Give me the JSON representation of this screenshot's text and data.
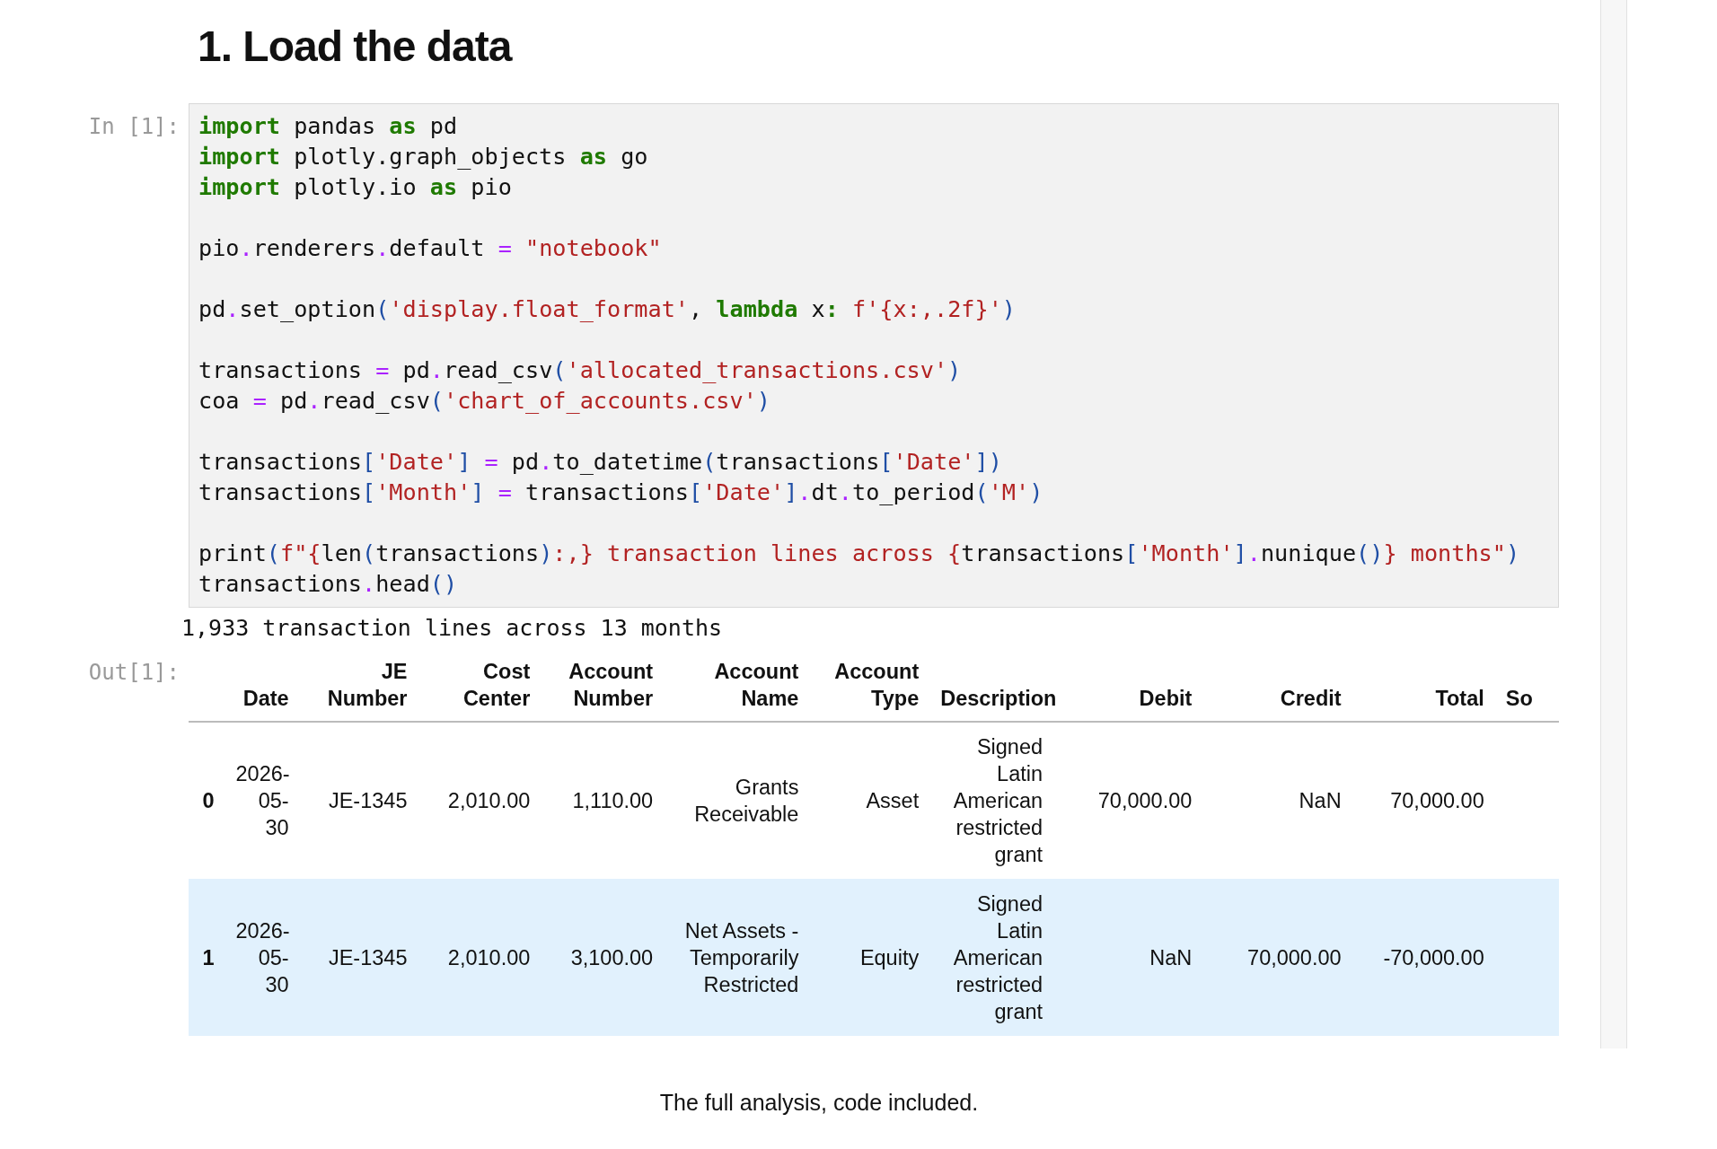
{
  "heading": "1. Load the data",
  "input_cell": {
    "prompt": "In [1]:",
    "lines": [
      {
        "kind": "code",
        "tokens": [
          {
            "kind": "kw",
            "text": "import"
          },
          {
            "kind": "plain",
            "text": " pandas "
          },
          {
            "kind": "kw",
            "text": "as"
          },
          {
            "kind": "plain",
            "text": " pd"
          }
        ]
      },
      {
        "kind": "code",
        "tokens": [
          {
            "kind": "kw",
            "text": "import"
          },
          {
            "kind": "plain",
            "text": " plotly.graph_objects "
          },
          {
            "kind": "kw",
            "text": "as"
          },
          {
            "kind": "plain",
            "text": " go"
          }
        ]
      },
      {
        "kind": "code",
        "tokens": [
          {
            "kind": "kw",
            "text": "import"
          },
          {
            "kind": "plain",
            "text": " plotly.io "
          },
          {
            "kind": "kw",
            "text": "as"
          },
          {
            "kind": "plain",
            "text": " pio"
          }
        ]
      },
      {
        "kind": "blank"
      },
      {
        "kind": "code",
        "tokens": [
          {
            "kind": "plain",
            "text": "pio"
          },
          {
            "kind": "op",
            "text": "."
          },
          {
            "kind": "plain",
            "text": "renderers"
          },
          {
            "kind": "op",
            "text": "."
          },
          {
            "kind": "plain",
            "text": "default "
          },
          {
            "kind": "op",
            "text": "="
          },
          {
            "kind": "str",
            "text": " \"notebook\""
          }
        ]
      },
      {
        "kind": "blank"
      },
      {
        "kind": "code",
        "tokens": [
          {
            "kind": "plain",
            "text": "pd"
          },
          {
            "kind": "op",
            "text": "."
          },
          {
            "kind": "plain",
            "text": "set_option"
          },
          {
            "kind": "paren",
            "text": "("
          },
          {
            "kind": "str",
            "text": "'display.float_format'"
          },
          {
            "kind": "plain",
            "text": ", "
          },
          {
            "kind": "kw",
            "text": "lambda"
          },
          {
            "kind": "plain",
            "text": " x"
          },
          {
            "kind": "kw",
            "text": ":"
          },
          {
            "kind": "str",
            "text": " f'{x:,.2f}'"
          },
          {
            "kind": "paren",
            "text": ")"
          }
        ]
      },
      {
        "kind": "blank"
      },
      {
        "kind": "code",
        "tokens": [
          {
            "kind": "plain",
            "text": "transactions "
          },
          {
            "kind": "op",
            "text": "="
          },
          {
            "kind": "plain",
            "text": " pd"
          },
          {
            "kind": "op",
            "text": "."
          },
          {
            "kind": "plain",
            "text": "read_csv"
          },
          {
            "kind": "paren",
            "text": "("
          },
          {
            "kind": "str",
            "text": "'allocated_transactions.csv'"
          },
          {
            "kind": "paren",
            "text": ")"
          }
        ]
      },
      {
        "kind": "code",
        "tokens": [
          {
            "kind": "plain",
            "text": "coa "
          },
          {
            "kind": "op",
            "text": "="
          },
          {
            "kind": "plain",
            "text": " pd"
          },
          {
            "kind": "op",
            "text": "."
          },
          {
            "kind": "plain",
            "text": "read_csv"
          },
          {
            "kind": "paren",
            "text": "("
          },
          {
            "kind": "str",
            "text": "'chart_of_accounts.csv'"
          },
          {
            "kind": "paren",
            "text": ")"
          }
        ]
      },
      {
        "kind": "blank"
      },
      {
        "kind": "code",
        "tokens": [
          {
            "kind": "plain",
            "text": "transactions"
          },
          {
            "kind": "paren",
            "text": "["
          },
          {
            "kind": "str",
            "text": "'Date'"
          },
          {
            "kind": "paren",
            "text": "] "
          },
          {
            "kind": "op",
            "text": "="
          },
          {
            "kind": "plain",
            "text": " pd"
          },
          {
            "kind": "op",
            "text": "."
          },
          {
            "kind": "plain",
            "text": "to_datetime"
          },
          {
            "kind": "paren",
            "text": "("
          },
          {
            "kind": "plain",
            "text": "transactions"
          },
          {
            "kind": "paren",
            "text": "["
          },
          {
            "kind": "str",
            "text": "'Date'"
          },
          {
            "kind": "paren",
            "text": "])"
          }
        ]
      },
      {
        "kind": "code",
        "tokens": [
          {
            "kind": "plain",
            "text": "transactions"
          },
          {
            "kind": "paren",
            "text": "["
          },
          {
            "kind": "str",
            "text": "'Month'"
          },
          {
            "kind": "paren",
            "text": "] "
          },
          {
            "kind": "op",
            "text": "="
          },
          {
            "kind": "plain",
            "text": " transactions"
          },
          {
            "kind": "paren",
            "text": "["
          },
          {
            "kind": "str",
            "text": "'Date'"
          },
          {
            "kind": "paren",
            "text": "]"
          },
          {
            "kind": "op",
            "text": "."
          },
          {
            "kind": "plain",
            "text": "dt"
          },
          {
            "kind": "op",
            "text": "."
          },
          {
            "kind": "plain",
            "text": "to_period"
          },
          {
            "kind": "paren",
            "text": "("
          },
          {
            "kind": "str",
            "text": "'M'"
          },
          {
            "kind": "paren",
            "text": ")"
          }
        ]
      },
      {
        "kind": "blank"
      },
      {
        "kind": "code",
        "tokens": [
          {
            "kind": "plain",
            "text": "print"
          },
          {
            "kind": "paren",
            "text": "("
          },
          {
            "kind": "str",
            "text": "f\"{"
          },
          {
            "kind": "plain",
            "text": "len"
          },
          {
            "kind": "paren",
            "text": "("
          },
          {
            "kind": "plain",
            "text": "transactions"
          },
          {
            "kind": "paren",
            "text": ")"
          },
          {
            "kind": "str",
            "text": ":,} transaction lines across {"
          },
          {
            "kind": "plain",
            "text": "transactions"
          },
          {
            "kind": "paren",
            "text": "["
          },
          {
            "kind": "str",
            "text": "'Month'"
          },
          {
            "kind": "paren",
            "text": "]"
          },
          {
            "kind": "op",
            "text": "."
          },
          {
            "kind": "plain",
            "text": "nunique"
          },
          {
            "kind": "paren",
            "text": "()"
          },
          {
            "kind": "str",
            "text": "} months\""
          },
          {
            "kind": "paren",
            "text": ")"
          }
        ]
      },
      {
        "kind": "code",
        "tokens": [
          {
            "kind": "plain",
            "text": "transactions"
          },
          {
            "kind": "op",
            "text": "."
          },
          {
            "kind": "plain",
            "text": "head"
          },
          {
            "kind": "paren",
            "text": "()"
          }
        ]
      }
    ]
  },
  "stdout": "1,933 transaction lines across 13 months",
  "output_cell": {
    "prompt": "Out[1]:",
    "table": {
      "columns": [
        "",
        "Date",
        "JE Number",
        "Cost Center",
        "Account Number",
        "Account Name",
        "Account Type",
        "Description",
        "Debit",
        "Credit",
        "Total",
        "So"
      ],
      "rows": [
        {
          "selected": false,
          "cells": [
            "0",
            "2026-05-30",
            "JE-1345",
            "2,010.00",
            "1,110.00",
            "Grants Receivable",
            "Asset",
            "Signed Latin American restricted grant",
            "70,000.00",
            "NaN",
            "70,000.00"
          ]
        },
        {
          "selected": true,
          "cells": [
            "1",
            "2026-05-30",
            "JE-1345",
            "2,010.00",
            "3,100.00",
            "Net Assets - Temporarily Restricted",
            "Equity",
            "Signed Latin American restricted grant",
            "NaN",
            "70,000.00",
            "-70,000.00"
          ]
        }
      ]
    }
  },
  "caption": "The full analysis, code included."
}
